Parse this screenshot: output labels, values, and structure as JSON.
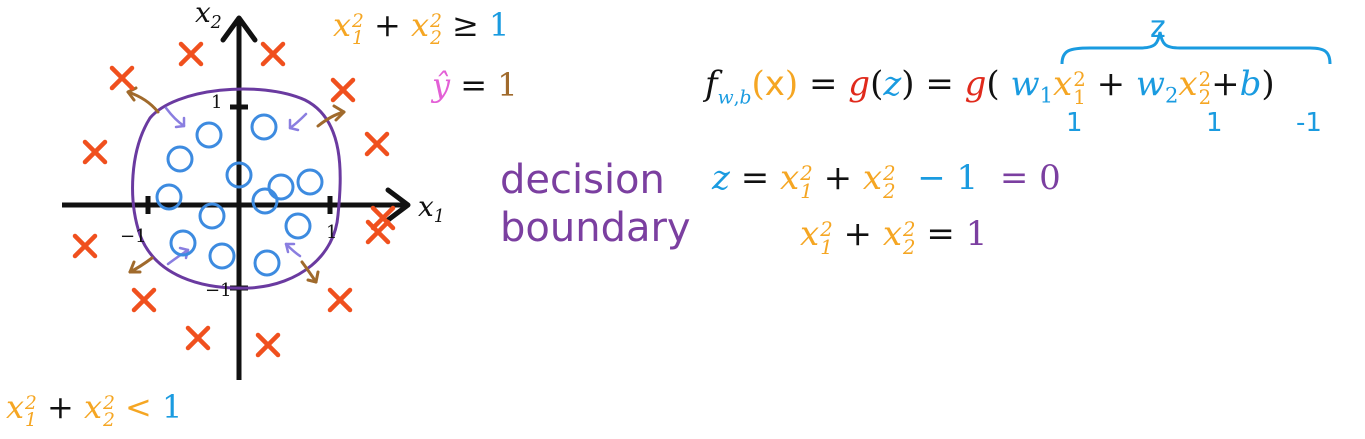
{
  "colors": {
    "orange": "#f5a623",
    "blue": "#1a9be0",
    "purple": "#7b3fa0",
    "red": "#e02a1c",
    "cross": "#f0501e",
    "brown": "#a06a2c",
    "pink": "#e35fd6",
    "black": "#111111"
  },
  "axes": {
    "x_label": "x",
    "x_sub": "1",
    "y_label": "x",
    "y_sub": "2",
    "tick_pos": "1",
    "tick_neg": "−1",
    "tick_x_pos": "1",
    "tick_x_neg": "−1"
  },
  "region_outside": {
    "x": "x",
    "sup": "2",
    "sub1": "1",
    "sub2": "2",
    "plus": "+",
    "op": "≥",
    "rhs": "1",
    "yhat": "ŷ",
    "eq": "=",
    "yval": "1"
  },
  "region_inside": {
    "x": "x",
    "sup": "2",
    "sub1": "1",
    "sub2": "2",
    "plus": "+",
    "op": "<",
    "rhs": "1"
  },
  "decision_label": {
    "line1": "decision",
    "line2": "boundary"
  },
  "model": {
    "f": "f",
    "f_sub_w": "w",
    "f_sub_b": "b",
    "paren_open": "(",
    "x_vec": "x",
    "paren_close": ")",
    "eq1": "=",
    "g1": "g",
    "z": "z",
    "eq2": "=",
    "g2": "g",
    "w1": "w",
    "w1_sub": "1",
    "x1": "x",
    "x1_sub": "1",
    "sq": "2",
    "plus1": "+",
    "w2": "w",
    "w2_sub": "2",
    "x2": "x",
    "x2_sub": "2",
    "plus2": "+",
    "b": "b",
    "brace_label": "z",
    "w1_val": "1",
    "w2_val": "1",
    "b_val": "-1"
  },
  "equations": {
    "z": "z",
    "eq": "=",
    "x": "x",
    "sup": "2",
    "sub1": "1",
    "sub2": "2",
    "plus": "+",
    "minus_one": "− 1",
    "equals_zero": "= 0",
    "equals_one": "=",
    "one": "1"
  }
}
